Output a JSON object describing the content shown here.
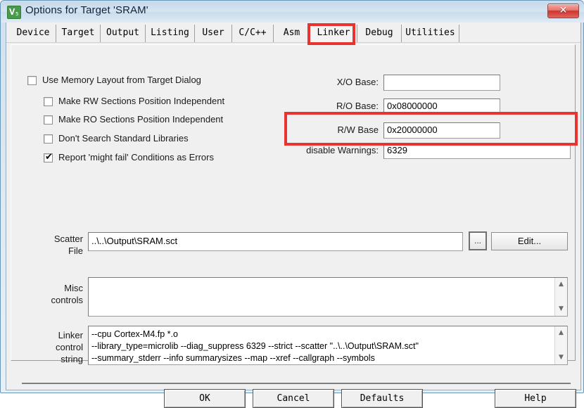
{
  "window": {
    "title": "Options for Target 'SRAM'",
    "app_icon": "keil-uvision-icon",
    "close_glyph": "✕",
    "accent_red": "#e8332f",
    "titlebar_blue": "#cfe0ef",
    "panel_gray": "#f0f0f0"
  },
  "tabs": [
    {
      "label": "Device",
      "selected": false
    },
    {
      "label": "Target",
      "selected": false
    },
    {
      "label": "Output",
      "selected": false
    },
    {
      "label": "Listing",
      "selected": false
    },
    {
      "label": "User",
      "selected": false
    },
    {
      "label": "C/C++",
      "selected": false
    },
    {
      "label": "Asm",
      "selected": false
    },
    {
      "label": "Linker",
      "selected": true
    },
    {
      "label": "Debug",
      "selected": false
    },
    {
      "label": "Utilities",
      "selected": false
    }
  ],
  "checkboxes": [
    {
      "label": "Use Memory Layout from Target Dialog",
      "checked": false,
      "tick": ""
    },
    {
      "label": "Make RW Sections Position Independent",
      "checked": false,
      "tick": ""
    },
    {
      "label": "Make RO Sections Position Independent",
      "checked": false,
      "tick": ""
    },
    {
      "label": "Don't Search Standard Libraries",
      "checked": false,
      "tick": ""
    },
    {
      "label": "Report 'might fail' Conditions as Errors",
      "checked": true,
      "tick": "✔"
    }
  ],
  "base_fields": [
    {
      "label": "X/O Base:",
      "value": "",
      "placeholder": ""
    },
    {
      "label": "R/O Base:",
      "value": "0x08000000",
      "placeholder": ""
    },
    {
      "label": "R/W Base",
      "value": "0x20000000",
      "placeholder": ""
    },
    {
      "label": "disable Warnings:",
      "value": "6329",
      "placeholder": ""
    }
  ],
  "scatter": {
    "label_line1": "Scatter",
    "label_line2": "File",
    "value": "..\\..\\Output\\SRAM.sct",
    "browse_label": "...",
    "edit_label": "Edit..."
  },
  "misc": {
    "label_line1": "Misc",
    "label_line2": "controls",
    "value": "",
    "scroll_up": "▲",
    "scroll_down": "▼"
  },
  "linker_control": {
    "label_line1": "Linker",
    "label_line2": "control",
    "label_line3": "string",
    "value": "--cpu Cortex-M4.fp *.o\n--library_type=microlib --diag_suppress 6329 --strict --scatter \"..\\..\\Output\\SRAM.sct\"\n--summary_stderr --info summarysizes --map --xref --callgraph --symbols",
    "scroll_up": "▲",
    "scroll_down": "▼"
  },
  "dialog_buttons": [
    {
      "label": "OK"
    },
    {
      "label": "Cancel"
    },
    {
      "label": "Defaults"
    },
    {
      "label": "Help"
    }
  ],
  "annotations": [
    {
      "name": "linker-tab-highlight",
      "target": "Linker"
    },
    {
      "name": "disable-warnings-highlight",
      "target": "disable Warnings: 6329"
    }
  ]
}
